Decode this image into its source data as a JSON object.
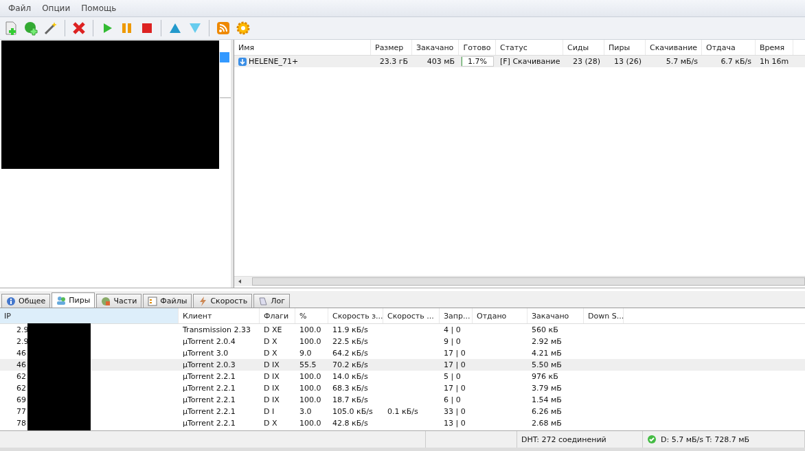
{
  "menu": [
    {
      "label": "Файл"
    },
    {
      "label": "Опции"
    },
    {
      "label": "Помощь"
    }
  ],
  "toolbar": [
    {
      "kind": "add-file"
    },
    {
      "kind": "add-url"
    },
    {
      "kind": "wizard"
    },
    {
      "kind": "sep"
    },
    {
      "kind": "remove"
    },
    {
      "kind": "sep"
    },
    {
      "kind": "start"
    },
    {
      "kind": "pause"
    },
    {
      "kind": "stop"
    },
    {
      "kind": "sep"
    },
    {
      "kind": "up"
    },
    {
      "kind": "down"
    },
    {
      "kind": "sep"
    },
    {
      "kind": "rss"
    },
    {
      "kind": "settings"
    }
  ],
  "torrents": {
    "columns": [
      "Имя",
      "Размер",
      "Закачано",
      "Готово",
      "Статус",
      "Сиды",
      "Пиры",
      "Скачивание",
      "Отдача",
      "Время"
    ],
    "rows": [
      {
        "name": "HELENE_71+",
        "size": "23.3 гБ",
        "downloaded": "403 мБ",
        "done": "1.7%",
        "level": 0.017,
        "status": "[F] Скачивание",
        "seeds": "23 (28)",
        "peers": "13 (26)",
        "down_speed": "5.7 мБ/s",
        "up_speed": "6.7 кБ/s",
        "time": "1h 16m",
        "selected": true
      }
    ]
  },
  "tabs": [
    {
      "label": "Общее",
      "kind": "info",
      "selected": false
    },
    {
      "label": "Пиры",
      "kind": "peers",
      "selected": true
    },
    {
      "label": "Части",
      "kind": "pieces",
      "selected": false
    },
    {
      "label": "Файлы",
      "kind": "files",
      "selected": false
    },
    {
      "label": "Скорость",
      "kind": "speed",
      "selected": false
    },
    {
      "label": "Лог",
      "kind": "log",
      "selected": false
    }
  ],
  "peers": {
    "columns": [
      "IP",
      "Клиент",
      "Флаги",
      "%",
      "Скорость з...",
      "Скорость ...",
      "Запр...",
      "Отдано",
      "Закачано",
      "Down S..."
    ],
    "rows": [
      {
        "ip": "2.9",
        "client": "Transmission 2.33",
        "flags": "D XE",
        "percent": "100.0",
        "down_speed": "11.9 кБ/s",
        "requests": "4 | 0",
        "downloaded": "560 кБ",
        "selected": false
      },
      {
        "ip": "2.9",
        "client": "µTorrent 2.0.4",
        "flags": "D X",
        "percent": "100.0",
        "down_speed": "22.5 кБ/s",
        "requests": "9 | 0",
        "downloaded": "2.92 мБ",
        "selected": false
      },
      {
        "ip": "46",
        "client": "µTorrent 3.0",
        "flags": "D X",
        "percent": "9.0",
        "down_speed": "64.2 кБ/s",
        "requests": "17 | 0",
        "downloaded": "4.21 мБ",
        "selected": false
      },
      {
        "ip": "46",
        "client": "µTorrent 2.0.3",
        "flags": "D IX",
        "percent": "55.5",
        "down_speed": "70.2 кБ/s",
        "requests": "17 | 0",
        "downloaded": "5.50 мБ",
        "selected": true
      },
      {
        "ip": "62",
        "client": "µTorrent 2.2.1",
        "flags": "D IX",
        "percent": "100.0",
        "down_speed": "14.0 кБ/s",
        "requests": "5 | 0",
        "downloaded": "976 кБ",
        "selected": false
      },
      {
        "ip": "62",
        "client": "µTorrent 2.2.1",
        "flags": "D IX",
        "percent": "100.0",
        "down_speed": "68.3 кБ/s",
        "requests": "17 | 0",
        "downloaded": "3.79 мБ",
        "selected": false
      },
      {
        "ip": "69",
        "client": "µTorrent 2.2.1",
        "flags": "D IX",
        "percent": "100.0",
        "down_speed": "18.7 кБ/s",
        "requests": "6 | 0",
        "downloaded": "1.54 мБ",
        "selected": false
      },
      {
        "ip": "77",
        "client": "µTorrent 2.2.1",
        "flags": "D I",
        "percent": "3.0",
        "down_speed": "105.0 кБ/s",
        "up_speed": "0.1 кБ/s",
        "requests": "33 | 0",
        "downloaded": "6.26 мБ",
        "selected": false
      },
      {
        "ip": "78",
        "client": "µTorrent 2.2.1",
        "flags": "D X",
        "percent": "100.0",
        "down_speed": "42.8 кБ/s",
        "requests": "13 | 0",
        "downloaded": "2.68 мБ",
        "selected": false
      }
    ]
  },
  "status": {
    "dht": "DHT: 272 соединений",
    "transfer": "D: 5.7 мБ/s T: 728.7 мБ"
  }
}
